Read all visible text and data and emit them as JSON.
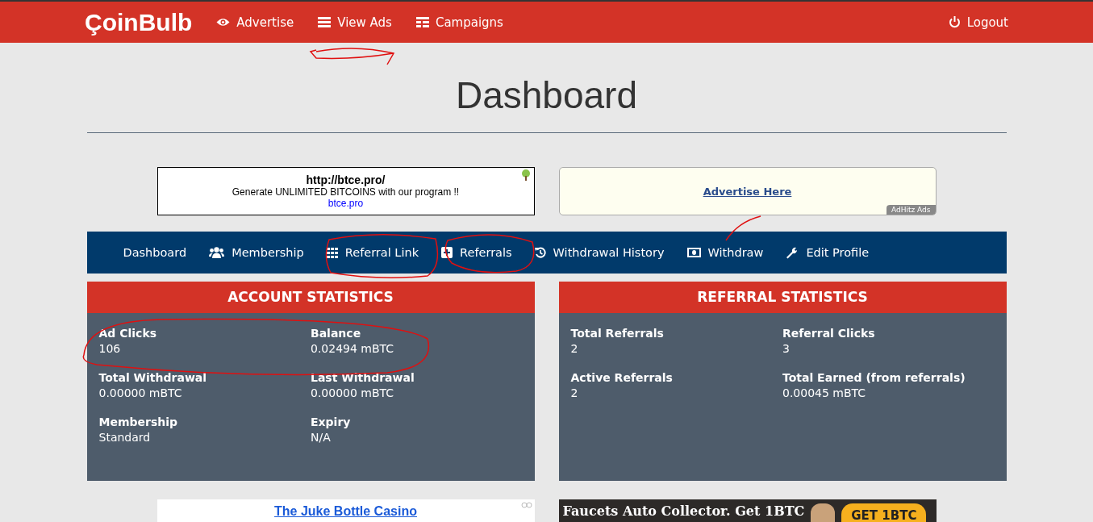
{
  "navbar": {
    "logo": "ÇoinBulb",
    "links": [
      {
        "label": "Advertise"
      },
      {
        "label": "View Ads"
      },
      {
        "label": "Campaigns"
      }
    ],
    "logout": "Logout"
  },
  "page_title": "Dashboard",
  "top_ads": {
    "text_ad": {
      "title": "http://btce.pro/",
      "description": "Generate UNLIMITED BITCOINS with our program !!",
      "url": "btce.pro"
    },
    "house_ad": {
      "link": "Advertise Here",
      "badge": "AdHitz Ads"
    }
  },
  "dashboard_nav": [
    {
      "label": "Dashboard"
    },
    {
      "label": "Membership"
    },
    {
      "label": "Referral Link"
    },
    {
      "label": "Referrals"
    },
    {
      "label": "Withdrawal History"
    },
    {
      "label": "Withdraw"
    },
    {
      "label": "Edit Profile"
    }
  ],
  "panels": [
    {
      "title": "ACCOUNT STATISTICS",
      "stats": [
        {
          "label": "Ad Clicks",
          "value": "106"
        },
        {
          "label": "Balance",
          "value": "0.02494 mBTC"
        },
        {
          "label": "Total Withdrawal",
          "value": "0.00000 mBTC"
        },
        {
          "label": "Last Withdrawal",
          "value": "0.00000 mBTC"
        },
        {
          "label": "Membership",
          "value": "Standard"
        },
        {
          "label": "Expiry",
          "value": "N/A"
        }
      ]
    },
    {
      "title": "REFERRAL STATISTICS",
      "stats": [
        {
          "label": "Total Referrals",
          "value": "2"
        },
        {
          "label": "Referral Clicks",
          "value": "3"
        },
        {
          "label": "Active Referrals",
          "value": "2"
        },
        {
          "label": "Total Earned (from referrals)",
          "value": "0.00045 mBTC"
        }
      ]
    }
  ],
  "bottom_ads": {
    "text_ad": {
      "title": "The Juke Bottle Casino"
    },
    "banner": {
      "headline": "Faucets Auto Collector. Get 1BTC",
      "button": "GET 1BTC"
    }
  }
}
